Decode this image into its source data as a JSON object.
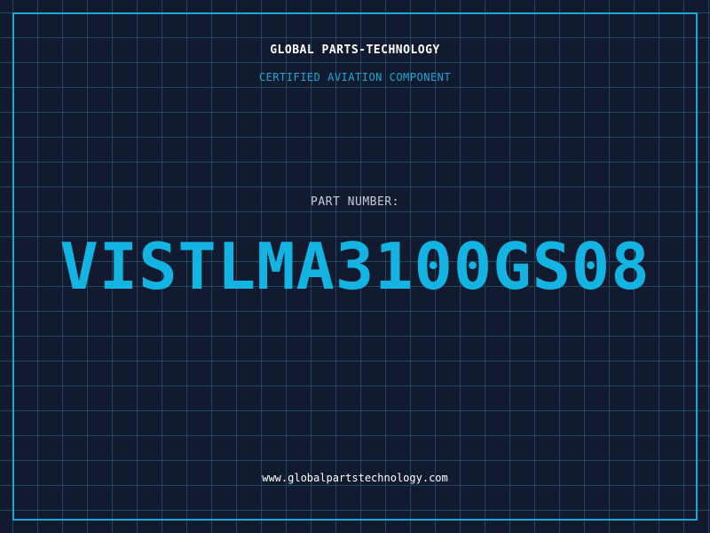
{
  "header": {
    "brand": "GLOBAL PARTS-TECHNOLOGY",
    "subtitle": "CERTIFIED AVIATION COMPONENT"
  },
  "part": {
    "label": "PART NUMBER:",
    "number": "VISTLMA3100GS08"
  },
  "footer": {
    "website": "www.globalpartstechnology.com"
  },
  "colors": {
    "background": "#121a30",
    "grid_line": "#1f4a5e",
    "accent": "#1aa8d6",
    "part_number": "#14b4e2",
    "label": "#c6ccd6",
    "text": "#ffffff"
  }
}
